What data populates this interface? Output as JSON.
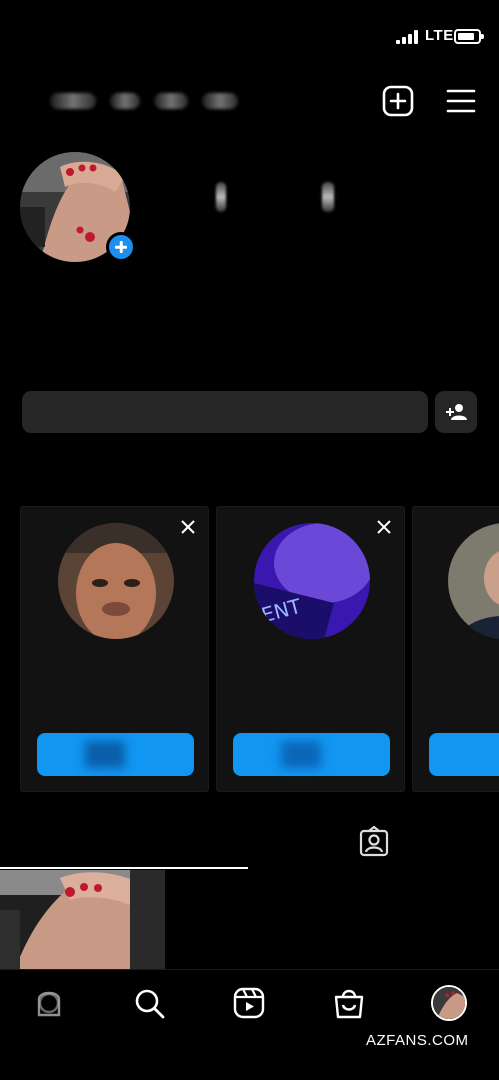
{
  "status_bar": {
    "network": "LTE"
  },
  "header": {
    "icons": {
      "new_post": "plus-square-icon",
      "menu": "hamburger-menu-icon"
    }
  },
  "profile": {
    "avatar_icon": "profile-avatar",
    "add_story_icon": "plus-circle-icon"
  },
  "actions": {
    "discover_icon": "add-person-icon"
  },
  "suggestions": [
    {
      "photo": "suggested-user-photo-1",
      "dismiss_icon": "close-icon",
      "button_color": "#1196f2"
    },
    {
      "photo": "suggested-user-photo-2",
      "dismiss_icon": "close-icon",
      "button_color": "#1196f2"
    },
    {
      "photo": "suggested-user-photo-3",
      "dismiss_icon": "close-icon",
      "button_color": "#1196f2"
    }
  ],
  "tabs": {
    "tagged_icon": "tagged-person-icon"
  },
  "bottom_nav": {
    "items": [
      "home-icon",
      "search-icon",
      "reels-icon",
      "shop-icon",
      "profile-avatar"
    ]
  },
  "colors": {
    "accent": "#1196f2",
    "background": "#000000",
    "surface": "#262626",
    "card": "#121212"
  },
  "watermark": "AZFANS.COM"
}
